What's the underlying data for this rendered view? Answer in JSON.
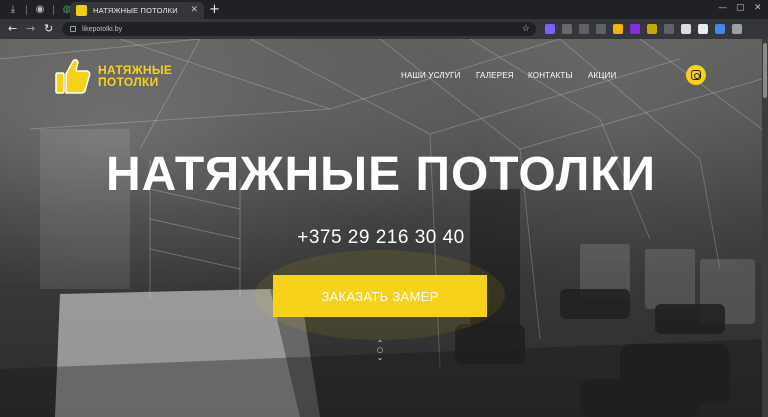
{
  "browser": {
    "tab_title": "НАТЯЖНЫЕ ПОТОЛКИ",
    "tab_close_glyph": "✕",
    "newtab_glyph": "+",
    "url": "likepotolki.by",
    "window_controls": [
      "—",
      "▢",
      "✕"
    ],
    "nav_glyphs": [
      "←",
      "→",
      "↻"
    ],
    "star_glyph": "☆",
    "extension_colors": [
      "#7b61ff",
      "#6a6a6a",
      "#5f6368",
      "#5f6368",
      "#f5b400",
      "#8a2be2",
      "#c9a800",
      "#5f6368",
      "#dcdcdc",
      "#e8eaed",
      "#4285f4",
      "#9aa0a6"
    ]
  },
  "site": {
    "logo_line1": "НАТЯЖНЫЕ",
    "logo_line2": "ПОТОЛКИ",
    "menu": [
      "НАШИ УСЛУГИ",
      "ГАЛЕРЕЯ",
      "КОНТАКТЫ",
      "АКЦИИ"
    ],
    "hero_title": "НАТЯЖНЫЕ ПОТОЛКИ",
    "phone": "+375 29 216 30 40",
    "cta_label": "ЗАКАЗАТЬ ЗАМЕР",
    "accent_color": "#f7d21a",
    "icons": [
      "thumbs-up-icon",
      "instagram-icon",
      "scroll-down-icon"
    ]
  }
}
